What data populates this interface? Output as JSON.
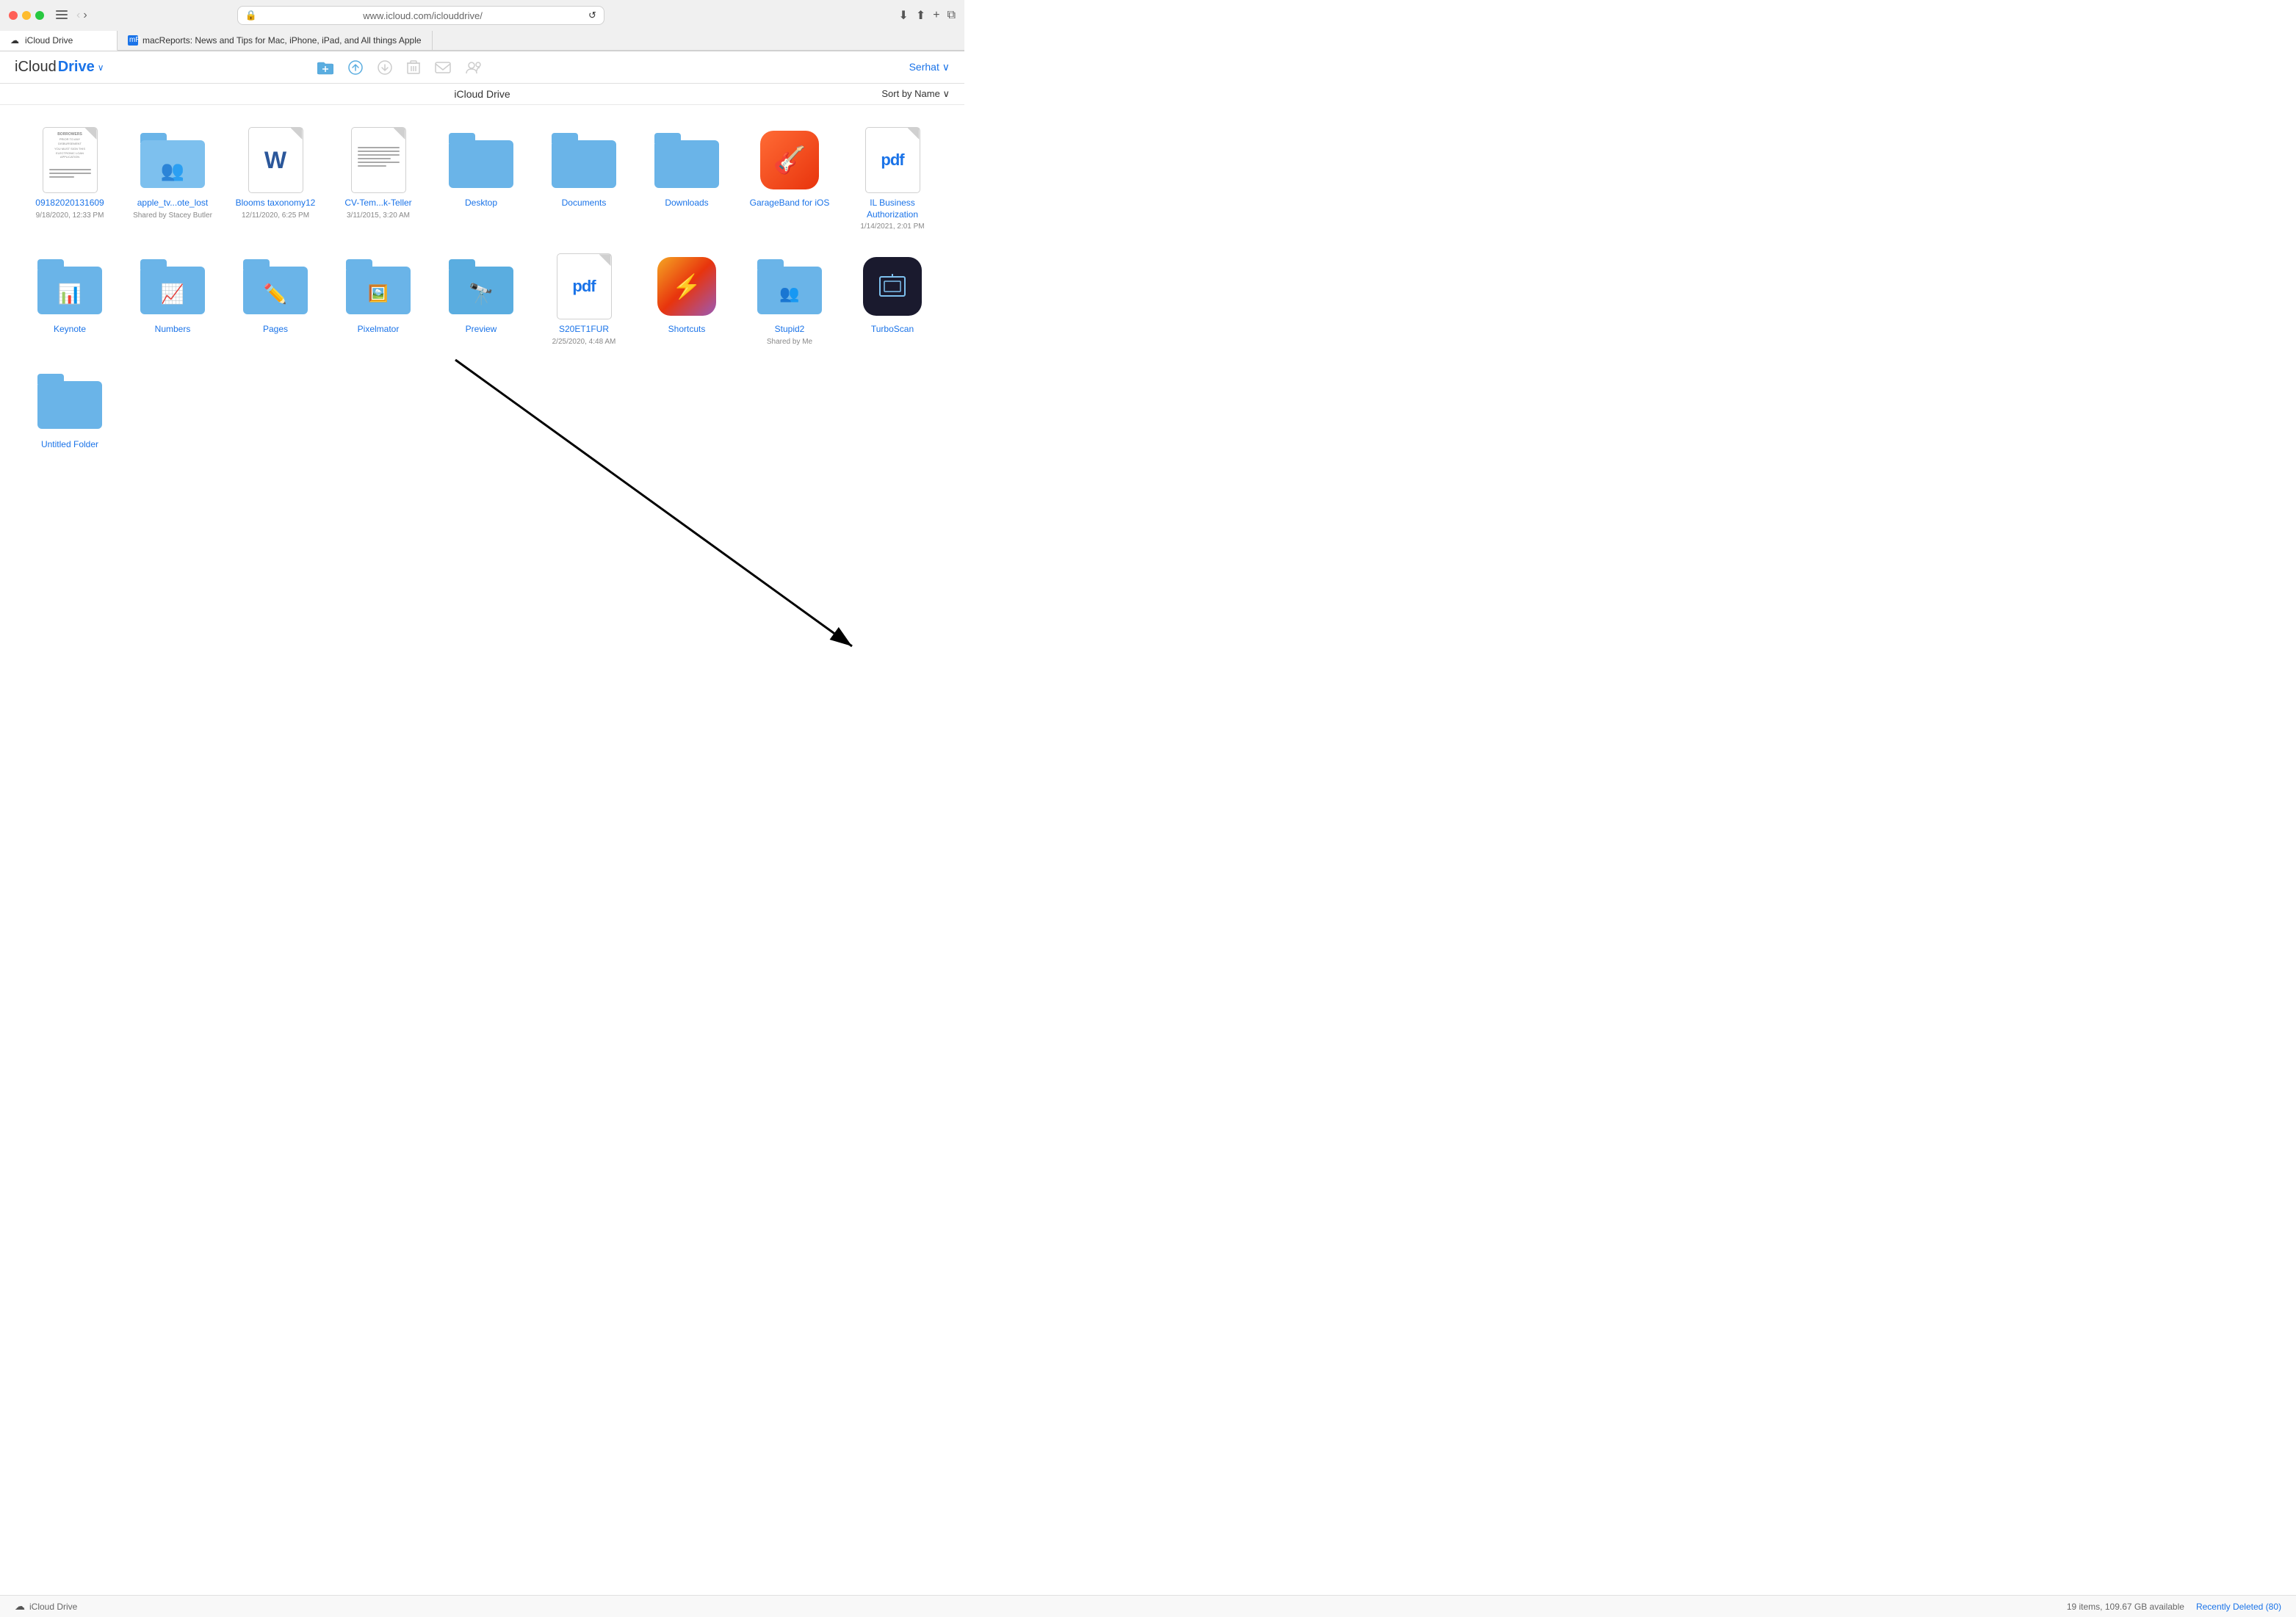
{
  "browser": {
    "traffic_lights": [
      "red",
      "yellow",
      "green"
    ],
    "url": "www.icloud.com/iclouddrive/",
    "tabs": [
      {
        "id": "tab1",
        "label": "iCloud Drive",
        "favicon": "☁",
        "active": true
      },
      {
        "id": "tab2",
        "label": "macReports: News and Tips for Mac, iPhone, iPad, and All things Apple",
        "favicon": "mR",
        "active": false
      }
    ]
  },
  "toolbar": {
    "brand_icloud": "iCloud",
    "brand_drive": "Drive",
    "dropdown_arrow": "∨",
    "user_label": "Serhat",
    "user_arrow": "∨",
    "sort_label": "Sort by Name",
    "sort_arrow": "∨"
  },
  "page_title": "iCloud Drive",
  "files": [
    {
      "id": "file1",
      "name": "09182020131609",
      "type": "document",
      "meta": "9/18/2020, 12:33 PM",
      "shared_by": null
    },
    {
      "id": "file2",
      "name": "apple_tv...ote_lost",
      "type": "folder-shared",
      "meta": "Shared by Stacey Butler",
      "shared_by": "Stacey Butler"
    },
    {
      "id": "file3",
      "name": "Blooms taxonomy12",
      "type": "word",
      "meta": "12/11/2020, 6:25 PM",
      "shared_by": null
    },
    {
      "id": "file4",
      "name": "CV-Tem...k-Teller",
      "type": "doc",
      "meta": "3/11/2015, 3:20 AM",
      "shared_by": null
    },
    {
      "id": "file5",
      "name": "Desktop",
      "type": "folder",
      "meta": null,
      "shared_by": null
    },
    {
      "id": "file6",
      "name": "Documents",
      "type": "folder",
      "meta": null,
      "shared_by": null
    },
    {
      "id": "file7",
      "name": "Downloads",
      "type": "folder",
      "meta": null,
      "shared_by": null
    },
    {
      "id": "file8",
      "name": "GarageBand for iOS",
      "type": "app-garageband",
      "meta": null,
      "shared_by": null
    },
    {
      "id": "file9",
      "name": "IL Business Authorization",
      "type": "pdf",
      "meta": "1/14/2021, 2:01 PM",
      "shared_by": null
    },
    {
      "id": "file10",
      "name": "Keynote",
      "type": "app-keynote",
      "meta": null,
      "shared_by": null
    },
    {
      "id": "file11",
      "name": "Numbers",
      "type": "app-numbers",
      "meta": null,
      "shared_by": null
    },
    {
      "id": "file12",
      "name": "Pages",
      "type": "app-pages",
      "meta": null,
      "shared_by": null
    },
    {
      "id": "file13",
      "name": "Pixelmator",
      "type": "app-pixelmator",
      "meta": null,
      "shared_by": null
    },
    {
      "id": "file14",
      "name": "Preview",
      "type": "folder-preview",
      "meta": null,
      "shared_by": null
    },
    {
      "id": "file15",
      "name": "S20ET1FUR",
      "type": "pdf",
      "meta": "2/25/2020, 4:48 AM",
      "shared_by": null
    },
    {
      "id": "file16",
      "name": "Shortcuts",
      "type": "app-shortcuts",
      "meta": null,
      "shared_by": null
    },
    {
      "id": "file17",
      "name": "Stupid2",
      "type": "folder-shared-me",
      "meta": "Shared by Me",
      "shared_by": "Me"
    },
    {
      "id": "file18",
      "name": "TurboScan",
      "type": "app-turboscan",
      "meta": null,
      "shared_by": null
    },
    {
      "id": "file19",
      "name": "Untitled Folder",
      "type": "folder",
      "meta": null,
      "shared_by": null
    }
  ],
  "status_bar": {
    "icloud_label": "iCloud Drive",
    "items_count": "19 items, 109.67 GB available",
    "recently_deleted": "Recently Deleted (80)"
  }
}
